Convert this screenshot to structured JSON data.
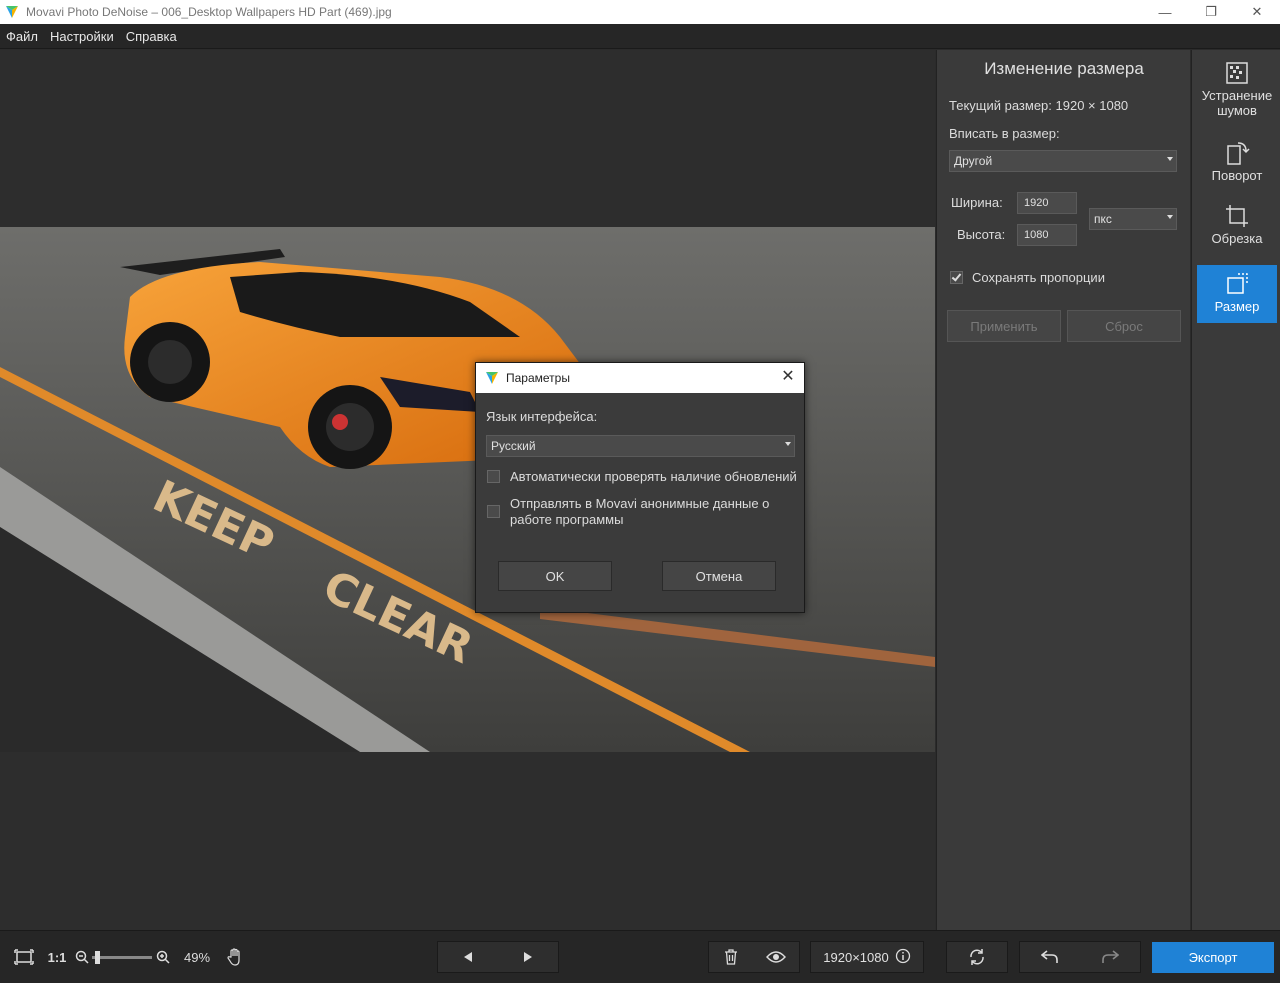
{
  "window": {
    "title": "Movavi Photo DeNoise – 006_Desktop Wallpapers  HD Part (469).jpg",
    "minimize": "—",
    "maximize": "❐",
    "close": "✕"
  },
  "menu": [
    "Файл",
    "Настройки",
    "Справка"
  ],
  "panel": {
    "title": "Изменение размера",
    "current_size": "Текущий размер: 1920 × 1080",
    "fit_label": "Вписать в размер:",
    "fit_value": "Другой",
    "width_label": "Ширина:",
    "width_value": "1920",
    "height_label": "Высота:",
    "height_value": "1080",
    "unit_value": "пкс",
    "keep_ratio_label": "Сохранять пропорции",
    "keep_ratio_checked": true,
    "apply_label": "Применить",
    "reset_label": "Сброс"
  },
  "tools": [
    {
      "label_line1": "Устранение",
      "label_line2": "шумов",
      "icon": "denoise-icon"
    },
    {
      "label_line1": "Поворот",
      "label_line2": "",
      "icon": "rotate-icon"
    },
    {
      "label_line1": "Обрезка",
      "label_line2": "",
      "icon": "crop-icon"
    },
    {
      "label_line1": "Размер",
      "label_line2": "",
      "icon": "resize-icon",
      "active": true
    }
  ],
  "bottom": {
    "ratio_label": "1:1",
    "zoom_percent": "49%",
    "zoom_level": 0.05,
    "image_size": "1920×1080",
    "export_label": "Экспорт"
  },
  "dialog": {
    "title": "Параметры",
    "language_label": "Язык интерфейса:",
    "language_value": "Русский",
    "auto_update_label": "Автоматически проверять наличие обновлений",
    "auto_update_checked": false,
    "send_data_line1": "Отправлять в Movavi анонимные данные о",
    "send_data_line2": "работе программы",
    "send_data_checked": false,
    "ok_label": "OK",
    "cancel_label": "Отмена"
  },
  "colors": {
    "accent": "#1f82d6",
    "panel_bg": "#3a3a3a",
    "canvas_bg": "#2d2d2d",
    "car_orange": "#f08a1c"
  }
}
